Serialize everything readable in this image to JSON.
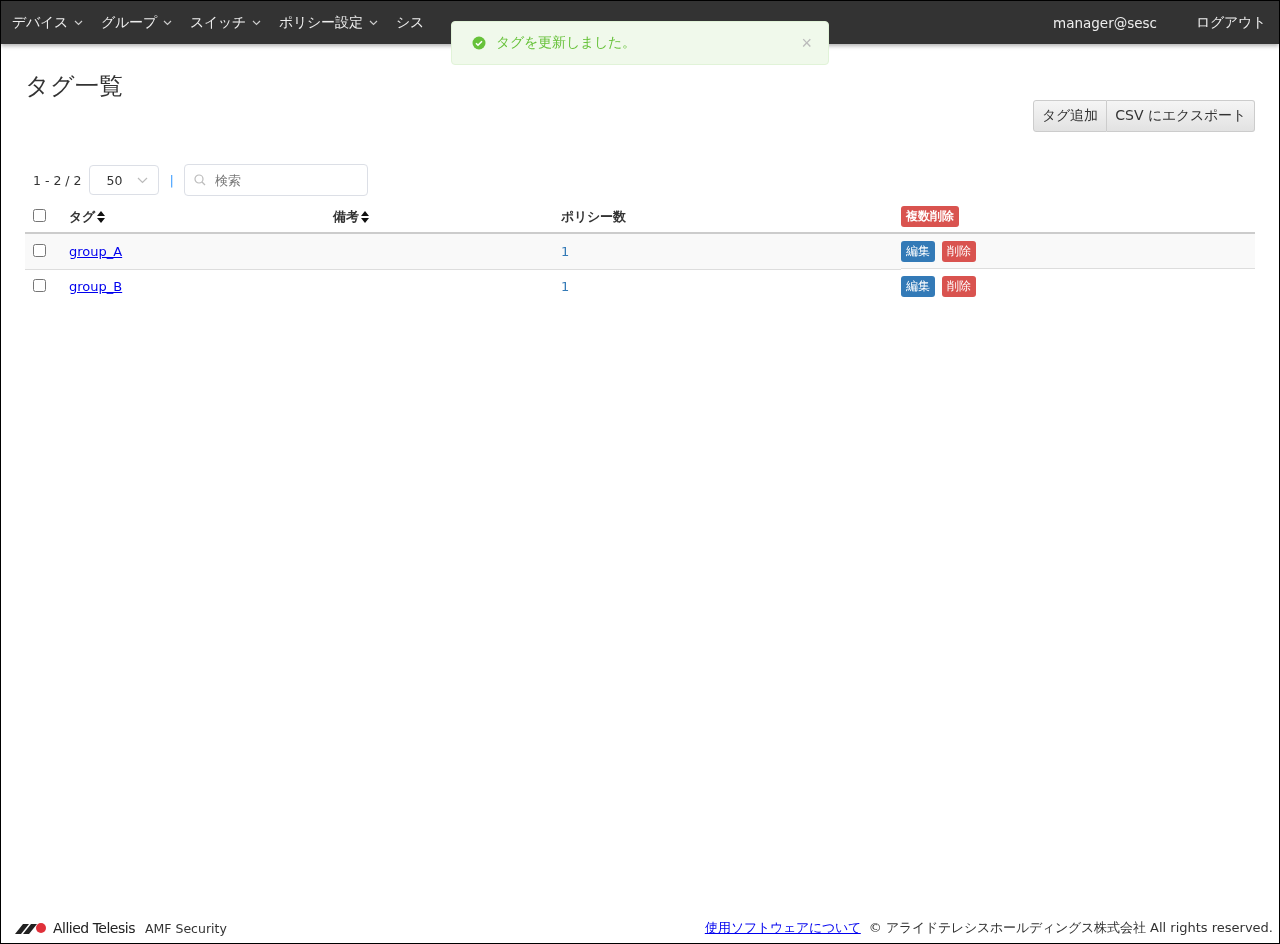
{
  "nav": {
    "menus": [
      {
        "label": "デバイス",
        "chevron": true
      },
      {
        "label": "グループ",
        "chevron": true
      },
      {
        "label": "スイッチ",
        "chevron": true
      },
      {
        "label": "ポリシー設定",
        "chevron": true
      },
      {
        "label": "シス",
        "chevron": false
      }
    ],
    "user": "manager@sesc",
    "logout": "ログアウト"
  },
  "toast": {
    "kind": "success",
    "message": "タグを更新しました。",
    "close": "×"
  },
  "title": "タグ一覧",
  "actions": [
    "タグ追加",
    "CSV にエクスポート"
  ],
  "pager": {
    "range": "1 - 2 / 2",
    "per_page": "50",
    "separator": "|",
    "search_placeholder": "検索"
  },
  "table": {
    "select_all_checked": false,
    "columns": [
      {
        "label": "タグ",
        "sortable": true
      },
      {
        "label": "備考",
        "sortable": true
      },
      {
        "label": "ポリシー数",
        "sortable": false
      }
    ],
    "bulk_delete": "複数削除",
    "rows": [
      {
        "checked": false,
        "tag": "group_A",
        "policies": "1",
        "edit": "編集",
        "delete": "削除"
      },
      {
        "checked": false,
        "tag": "group_B",
        "policies": "1",
        "edit": "編集",
        "delete": "削除"
      }
    ]
  },
  "footer": {
    "logo": "Allied Telesis",
    "product": "AMF Security",
    "link": "使用ソフトウェアについて",
    "copyright": "© アライドテレシスホールディングス株式会社 All rights reserved."
  }
}
